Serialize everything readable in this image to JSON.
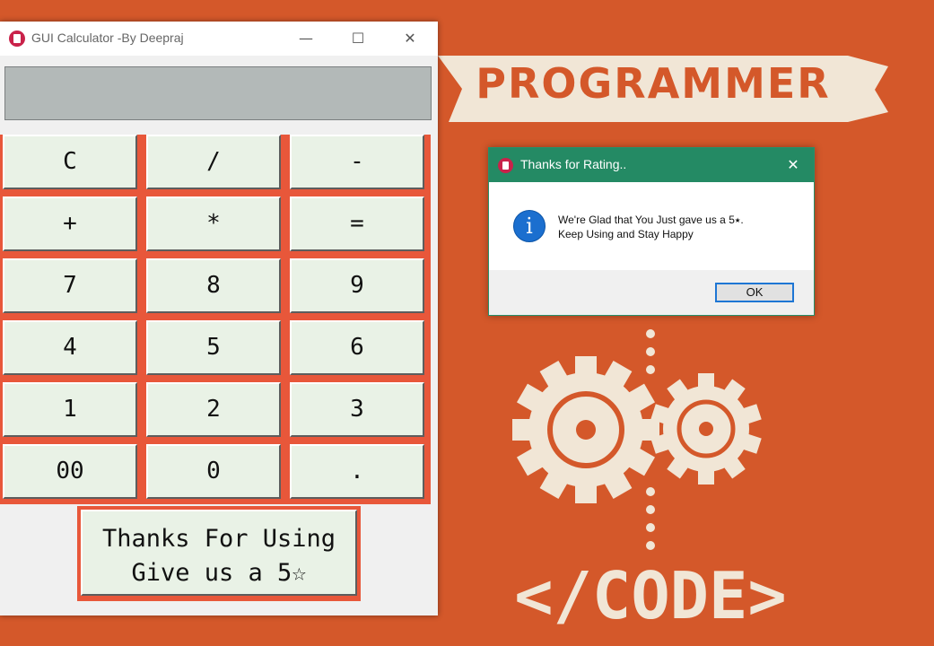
{
  "wallpaper": {
    "banner_text": "PROGRAMMER",
    "code_text": "</CODE>"
  },
  "calculator": {
    "window_title": "GUI Calculator -By Deepraj",
    "controls": {
      "minimize": "—",
      "maximize": "☐",
      "close": "✕"
    },
    "display_value": "",
    "buttons": [
      [
        "C",
        "/",
        "-"
      ],
      [
        "+",
        "*",
        "="
      ],
      [
        "7",
        "8",
        "9"
      ],
      [
        "4",
        "5",
        "6"
      ],
      [
        "1",
        "2",
        "3"
      ],
      [
        "00",
        "0",
        "."
      ]
    ],
    "thanks_button": {
      "line1": "Thanks For Using",
      "line2": "Give us a 5☆"
    }
  },
  "dialog": {
    "title": "Thanks for Rating..",
    "close": "✕",
    "info_glyph": "i",
    "message_line1": "We're Glad that You Just gave us a 5⭑.",
    "message_line2": "Keep Using and Stay Happy",
    "ok_label": "OK"
  },
  "colors": {
    "wallpaper": "#d4582a",
    "button_face": "#e9f2e6",
    "button_frame": "#e8573a",
    "display": "#b3b9b8",
    "dialog_title": "#248a64",
    "info_blue": "#1b6fcf"
  }
}
